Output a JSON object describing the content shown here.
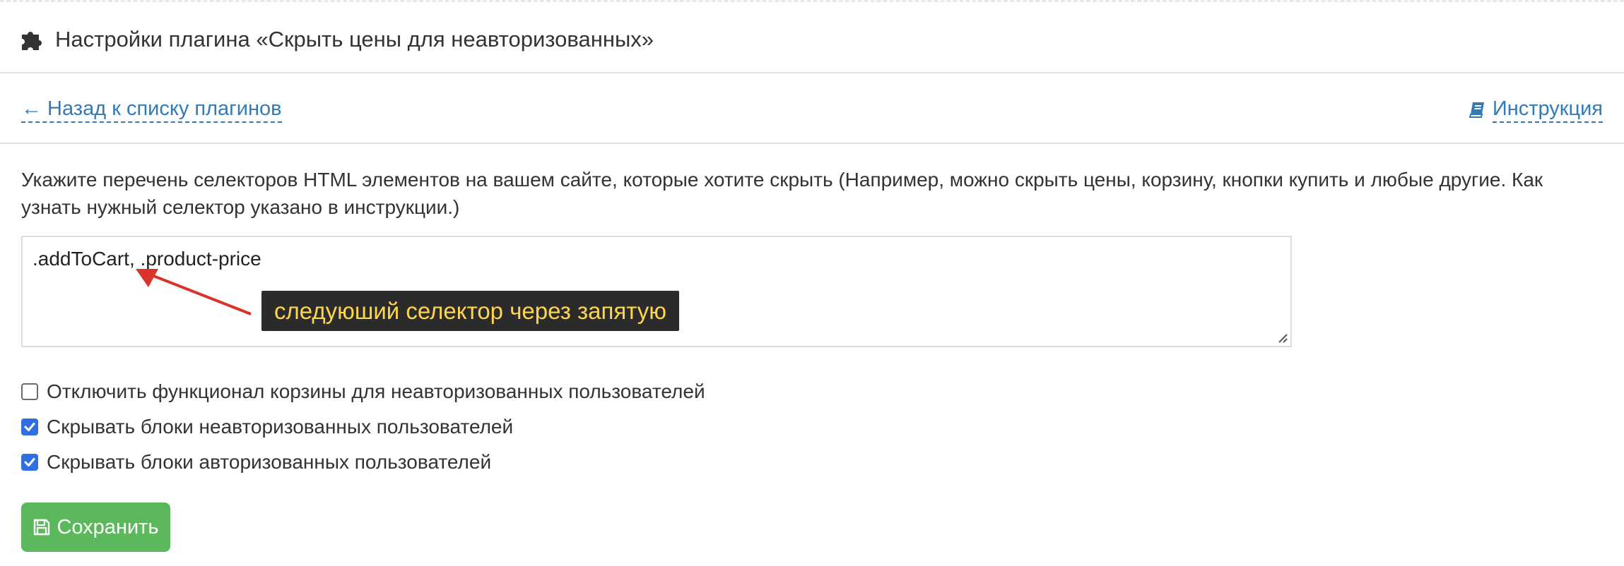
{
  "header": {
    "title": "Настройки плагина «Скрыть цены для неавторизованных»",
    "icon": "puzzle-icon"
  },
  "nav": {
    "back_label": "← Назад к списку плагинов",
    "manual_label": "Инструкция",
    "manual_icon": "book-icon"
  },
  "form": {
    "description": "Укажите перечень селекторов HTML элементов на вашем сайте, которые хотите скрыть (Например, можно скрыть цены, корзину, кнопки купить и любые другие. Как узнать нужный селектор указано в инструкции.)",
    "selectors_value": ".addToCart, .product-price",
    "annotation": "следуюший селектор через запятую",
    "checkboxes": [
      {
        "label": "Отключить функционал корзины для неавторизованных пользователей",
        "checked": false
      },
      {
        "label": "Скрывать блоки неавторизованных пользователей",
        "checked": true
      },
      {
        "label": "Скрывать блоки авторизованных пользователей",
        "checked": true
      }
    ],
    "save_label": "Сохранить",
    "save_icon": "floppy-disk-icon"
  },
  "colors": {
    "link": "#337ab7",
    "save_button": "#5cb85c",
    "checkbox_checked": "#2f6fe4",
    "annotation_bg": "#2b2b2b",
    "annotation_text": "#ffd54a",
    "arrow": "#d9342b"
  }
}
